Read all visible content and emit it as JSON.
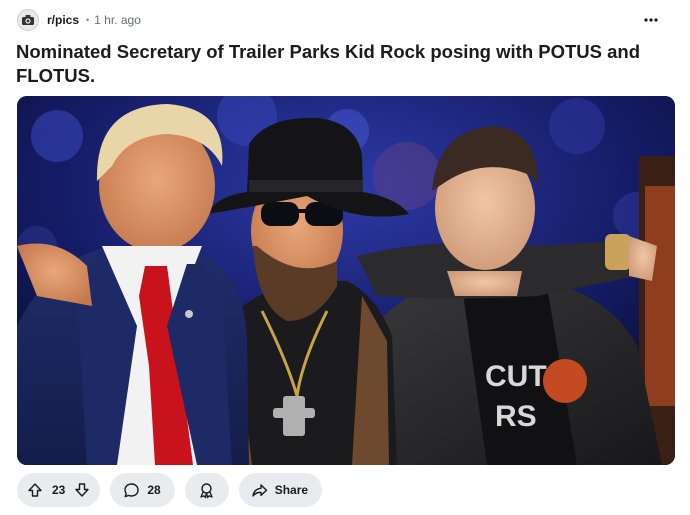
{
  "post": {
    "subreddit": "r/pics",
    "age": "1 hr. ago",
    "title": "Nominated Secretary of Trailer Parks Kid Rock posing with POTUS and FLOTUS.",
    "votes": "23",
    "comments": "28",
    "share_label": "Share",
    "shirt_text_1": "CUT",
    "shirt_text_2": "RS"
  },
  "icons": {
    "more": "ellipsis-icon",
    "upvote": "arrow-up-icon",
    "downvote": "arrow-down-icon",
    "comment": "speech-bubble-icon",
    "award": "award-ribbon-icon",
    "share": "share-arrow-icon"
  },
  "colors": {
    "pill_bg": "#e8ecef",
    "text": "#1a1a1b",
    "muted": "#6b6f72",
    "image_bg": "#0a0d2e"
  }
}
